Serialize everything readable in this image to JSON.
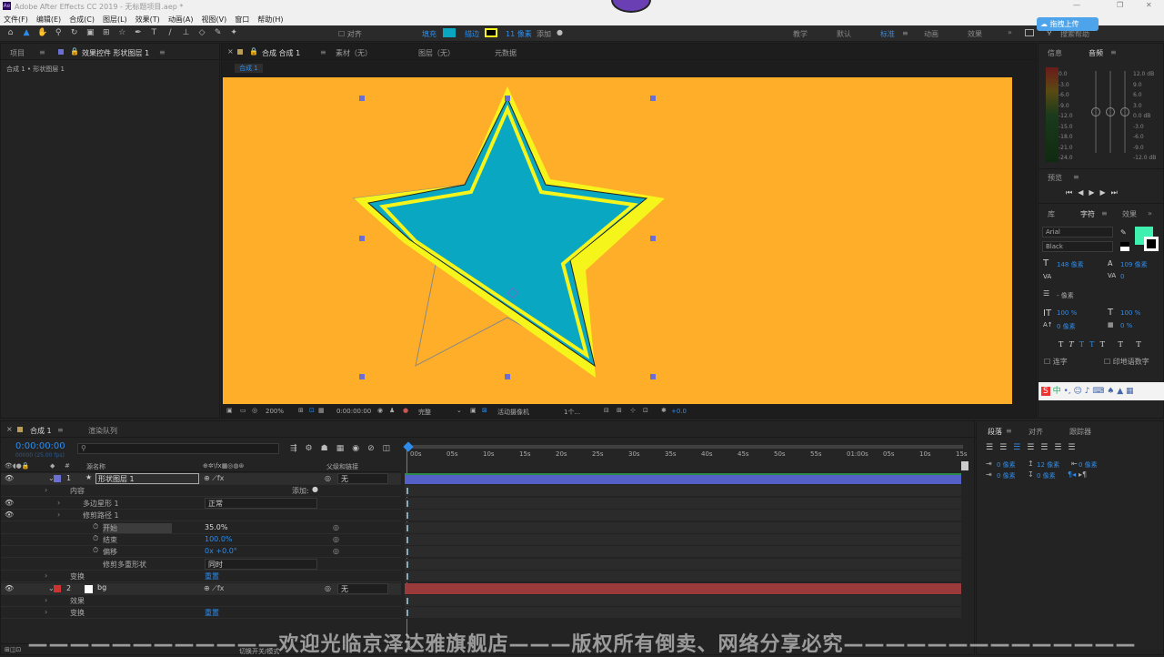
{
  "app": {
    "title": "Adobe After Effects CC 2019 - 无标题项目.aep *"
  },
  "menu": [
    "文件(F)",
    "编辑(E)",
    "合成(C)",
    "图层(L)",
    "效果(T)",
    "动画(A)",
    "视图(V)",
    "窗口",
    "帮助(H)"
  ],
  "toolbar": {
    "align": "对齐",
    "fill_label": "填充",
    "stroke_label": "描边",
    "stroke_width": "11 像素",
    "add_label": "添加",
    "workspaces": [
      "教学",
      "默认",
      "标准",
      "动画",
      "效果"
    ],
    "active_workspace": "标准",
    "search_placeholder": "搜索帮助",
    "upload_badge": "拖拽上传"
  },
  "left_panel": {
    "tabs": [
      "项目",
      "效果控件 形状图层 1"
    ],
    "path": "合成 1 • 形状图层 1"
  },
  "comp_panel": {
    "tabs": [
      "合成 合成 1",
      "素材（无）",
      "图层（无）",
      "元数据"
    ],
    "subtab": "合成 1",
    "zoom": "200%",
    "time": "0:00:00:00",
    "quality": "完整",
    "camera": "活动摄像机",
    "views": "1个...",
    "exposure": "+0.0"
  },
  "right_panel": {
    "info_tab": "信息",
    "audio_tab": "音频",
    "audio_left": [
      "0.0",
      "-3.0",
      "-6.0",
      "-9.0",
      "-12.0",
      "-15.0",
      "-18.0",
      "-21.0",
      "-24.0"
    ],
    "audio_right": [
      "12.0 dB",
      "9.0",
      "6.0",
      "3.0",
      "0.0 dB",
      "-3.0",
      "-6.0",
      "-9.0",
      "-12.0 dB"
    ],
    "preview_tab": "预览",
    "lib_tab": "库",
    "char_tab": "字符",
    "effects_tab": "效果",
    "font": "Arial",
    "style": "Black",
    "size": "148 像素",
    "leading": "109 像素",
    "kerning": "0",
    "stroke_px": "- 像素",
    "vscale": "100 %",
    "hscale": "100 %",
    "baseline": "0 像素",
    "tsume": "0 %",
    "ligature": "连字",
    "hindi": "印地语数字",
    "fill_color": "#3ff0b0"
  },
  "timeline": {
    "tabs": [
      "合成 1",
      "渲染队列"
    ],
    "timecode": "0:00:00:00",
    "fps": "00000 (25.00 fps)",
    "col_source": "源名称",
    "col_parent": "父级和链接",
    "ruler": [
      "00s",
      "05s",
      "10s",
      "15s",
      "20s",
      "25s",
      "30s",
      "35s",
      "40s",
      "45s",
      "50s",
      "55s",
      "01:00s",
      "05s",
      "10s",
      "15s"
    ],
    "bottom": "切换开关/模式"
  },
  "layers": [
    {
      "num": "1",
      "name": "形状图层 1",
      "parent": "无"
    },
    {
      "label": "内容",
      "add": "添加:"
    },
    {
      "label": "多边星形 1",
      "mode": "正常"
    },
    {
      "label": "修剪路径 1"
    },
    {
      "label": "开始",
      "value": "35.0%"
    },
    {
      "label": "结束",
      "value": "100.0%"
    },
    {
      "label": "偏移",
      "value": "0x +0.0°"
    },
    {
      "label": "修剪多重形状",
      "mode": "同时"
    },
    {
      "label": "变换",
      "value": "重置"
    },
    {
      "num": "2",
      "name": "bg",
      "parent": "无"
    },
    {
      "label": "效果"
    },
    {
      "label": "变换",
      "value": "重置"
    }
  ],
  "paragraph": {
    "tabs": [
      "段落",
      "对齐",
      "跟踪器"
    ],
    "values": [
      "0 像素",
      "0 像素",
      "0 像素",
      "12 像素",
      "0 像素"
    ]
  },
  "watermark": "————————————欢迎光临京泽达雅旗舰店———版权所有倒卖、网络分享必究——————————————",
  "colors": {
    "canvas": "#ffae2a",
    "star_fill": "#0aa7c2",
    "star_stroke": "#f5f51b",
    "accent": "#2d8ceb"
  }
}
